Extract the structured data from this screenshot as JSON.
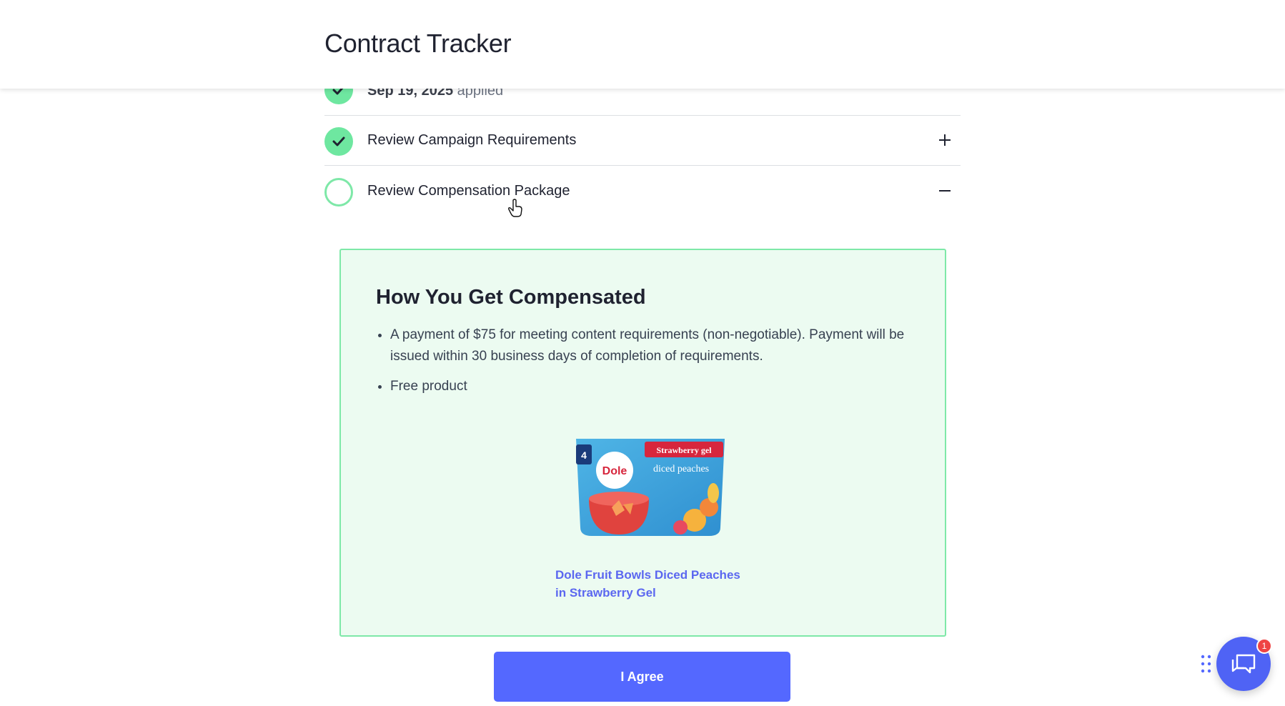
{
  "header": {
    "title": "Contract Tracker"
  },
  "steps": [
    {
      "date": "Sep 19, 2025",
      "status": "applied"
    },
    {
      "label": "Review Campaign Requirements",
      "toggle": "plus"
    },
    {
      "label": "Review Compensation Package",
      "toggle": "minus"
    }
  ],
  "compensation": {
    "heading": "How You Get Compensated",
    "bullets": [
      "A payment of $75 for meeting content requirements (non-negotiable). Payment will be issued within 30 business days of completion of requirements.",
      "Free product"
    ],
    "product": {
      "image_alt": "Dole Fruit Bowls Diced Peaches in Strawberry Gel package",
      "brand": "Dole",
      "pack_count": "4",
      "flavor": "Strawberry gel",
      "product_text": "diced peaches",
      "link_line1": "Dole Fruit Bowls Diced Peaches",
      "link_line2": "in Strawberry Gel"
    }
  },
  "actions": {
    "agree_label": "I Agree"
  },
  "chat": {
    "badge_count": "1"
  },
  "colors": {
    "accent": "#5468ff",
    "success": "#6ee7a0",
    "panel_bg": "#ecfbf1",
    "link": "#5b67f0"
  }
}
